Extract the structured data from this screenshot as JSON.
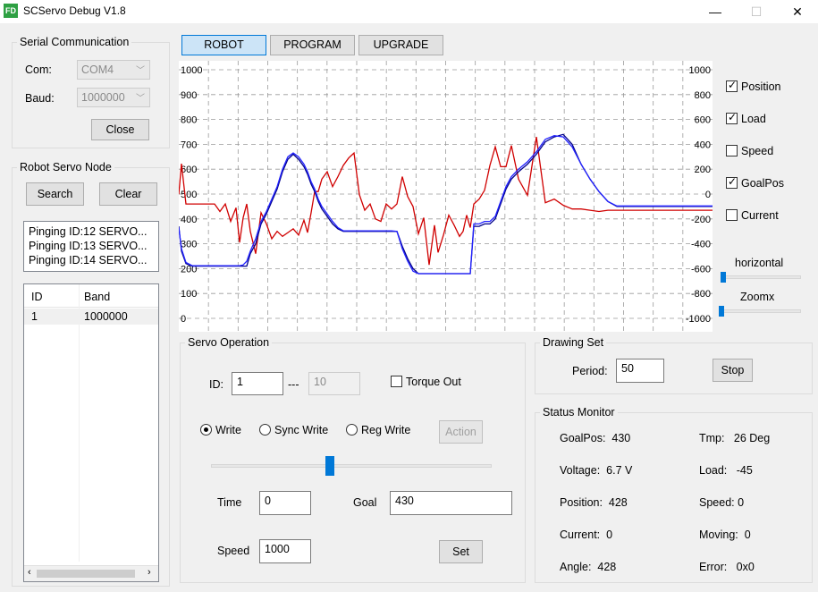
{
  "window": {
    "icon_text": "FD",
    "title": "SCServo Debug V1.8",
    "minimize": "—",
    "maximize": "☐",
    "close": "✕"
  },
  "serial": {
    "title": "Serial Communication",
    "com_label": "Com:",
    "com_value": "COM4",
    "baud_label": "Baud:",
    "baud_value": "1000000",
    "close_button": "Close"
  },
  "node": {
    "title": "Robot Servo Node",
    "search": "Search",
    "clear": "Clear",
    "log": [
      "Pinging ID:12 SERVO...",
      "Pinging ID:13 SERVO...",
      "Pinging ID:14 SERVO..."
    ],
    "columns": [
      "ID",
      "Band"
    ],
    "rows": [
      [
        "1",
        "1000000"
      ]
    ]
  },
  "tabs": [
    "ROBOT",
    "PROGRAM",
    "UPGRADE"
  ],
  "chart_data": {
    "type": "line",
    "x": [
      0,
      3,
      8,
      15,
      22,
      28,
      34,
      40,
      46,
      52,
      58,
      64,
      68,
      72,
      76,
      80,
      86,
      92,
      98,
      104,
      110,
      116,
      122,
      128,
      134,
      140,
      144,
      148,
      152,
      156,
      160,
      166,
      172,
      178,
      184,
      190,
      196,
      202,
      208,
      214,
      220,
      226,
      232,
      238,
      244,
      250,
      256,
      262,
      268,
      274,
      280,
      286,
      290,
      296,
      302,
      308,
      314,
      318,
      322,
      326,
      330,
      336,
      342,
      348,
      354,
      360,
      366,
      372,
      380,
      390,
      400,
      410,
      420,
      430,
      440,
      450,
      460,
      470,
      480,
      490,
      500,
      510,
      520,
      530,
      540,
      550,
      560,
      570,
      580,
      590,
      597
    ],
    "y_left_ticks": [
      0,
      100,
      200,
      300,
      400,
      500,
      600,
      700,
      800,
      900,
      1000
    ],
    "y_right_ticks": [
      -1000,
      -800,
      -600,
      -400,
      -200,
      0,
      200,
      400,
      600,
      800,
      1000
    ],
    "ylim_left": [
      0,
      1000
    ],
    "ylim_right": [
      -1000,
      1000
    ],
    "series": [
      {
        "color": "#d00000",
        "axis": "right",
        "values": [
          -2,
          244,
          -80,
          -80,
          -80,
          -80,
          -80,
          -80,
          -140,
          -80,
          -220,
          -110,
          -390,
          -190,
          -80,
          -300,
          -480,
          -150,
          -240,
          -360,
          -300,
          -340,
          -310,
          -280,
          -330,
          -210,
          -310,
          -150,
          20,
          20,
          120,
          180,
          60,
          140,
          230,
          290,
          330,
          -5,
          -130,
          -80,
          -200,
          -220,
          -80,
          -120,
          -80,
          140,
          -20,
          -100,
          -320,
          -190,
          -570,
          -250,
          -470,
          -330,
          -170,
          -250,
          -340,
          -300,
          -170,
          -270,
          -80,
          -40,
          30,
          230,
          380,
          220,
          220,
          390,
          120,
          -10,
          460,
          -70,
          -40,
          -90,
          -120,
          -120,
          -130,
          -140,
          -130,
          -130,
          -130,
          -130,
          -130,
          -130,
          -130,
          -130,
          -130,
          -130,
          -130,
          -130,
          -130
        ]
      },
      {
        "color": "#00008b",
        "axis": "left",
        "values": [
          370,
          270,
          220,
          210,
          210,
          210,
          210,
          210,
          210,
          210,
          210,
          210,
          210,
          210,
          210,
          260,
          300,
          380,
          420,
          470,
          520,
          590,
          640,
          660,
          640,
          610,
          580,
          540,
          510,
          470,
          440,
          410,
          380,
          360,
          350,
          350,
          350,
          350,
          350,
          350,
          350,
          350,
          350,
          350,
          350,
          290,
          240,
          200,
          180,
          180,
          180,
          180,
          180,
          180,
          180,
          180,
          180,
          180,
          180,
          180,
          370,
          370,
          380,
          380,
          400,
          460,
          520,
          560,
          590,
          620,
          660,
          710,
          730,
          740,
          700,
          620,
          560,
          510,
          470,
          450,
          450,
          450,
          450,
          450,
          450,
          450,
          450,
          450,
          450,
          450,
          450
        ]
      },
      {
        "color": "#2222ff",
        "axis": "left",
        "values": [
          365,
          280,
          225,
          212,
          212,
          212,
          212,
          212,
          212,
          212,
          212,
          212,
          212,
          215,
          230,
          270,
          320,
          390,
          430,
          480,
          530,
          600,
          650,
          665,
          650,
          620,
          590,
          550,
          520,
          480,
          450,
          420,
          390,
          365,
          352,
          352,
          352,
          352,
          352,
          352,
          352,
          352,
          352,
          352,
          350,
          280,
          230,
          190,
          180,
          180,
          180,
          180,
          180,
          180,
          180,
          180,
          180,
          180,
          180,
          180,
          380,
          380,
          390,
          390,
          410,
          470,
          530,
          570,
          600,
          630,
          670,
          720,
          735,
          730,
          690,
          620,
          560,
          510,
          470,
          452,
          452,
          452,
          452,
          452,
          452,
          452,
          452,
          452,
          452,
          452,
          452
        ]
      }
    ]
  },
  "legend": {
    "position": "Position",
    "load": "Load",
    "speed": "Speed",
    "goalpos": "GoalPos",
    "current": "Current"
  },
  "sliders": {
    "horizontal": "horizontal",
    "zoomx": "Zoomx"
  },
  "servo_op": {
    "title": "Servo Operation",
    "id_label": "ID:",
    "id_value": "1",
    "range_sep": "---",
    "range_value": "10",
    "torque_out": "Torque Out",
    "write": "Write",
    "sync_write": "Sync Write",
    "reg_write": "Reg Write",
    "action": "Action",
    "time_label": "Time",
    "time_value": "0",
    "goal_label": "Goal",
    "goal_value": "430",
    "speed_label": "Speed",
    "speed_value": "1000",
    "set": "Set"
  },
  "drawing": {
    "title": "Drawing Set",
    "period_label": "Period:",
    "period_value": "50",
    "stop": "Stop"
  },
  "status": {
    "title": "Status Monitor",
    "left": [
      {
        "label": "GoalPos:",
        "value": "430"
      },
      {
        "label": "Voltage:",
        "value": "6.7 V"
      },
      {
        "label": "Position:",
        "value": "428"
      },
      {
        "label": "Current:",
        "value": "0"
      },
      {
        "label": "Angle:",
        "value": "428"
      }
    ],
    "right": [
      {
        "label": "Tmp:",
        "value": "26 Deg"
      },
      {
        "label": "Load:",
        "value": "-45"
      },
      {
        "label": "Speed:",
        "value": "0"
      },
      {
        "label": "Moving:",
        "value": "0"
      },
      {
        "label": "Error:",
        "value": "0x0"
      }
    ]
  }
}
